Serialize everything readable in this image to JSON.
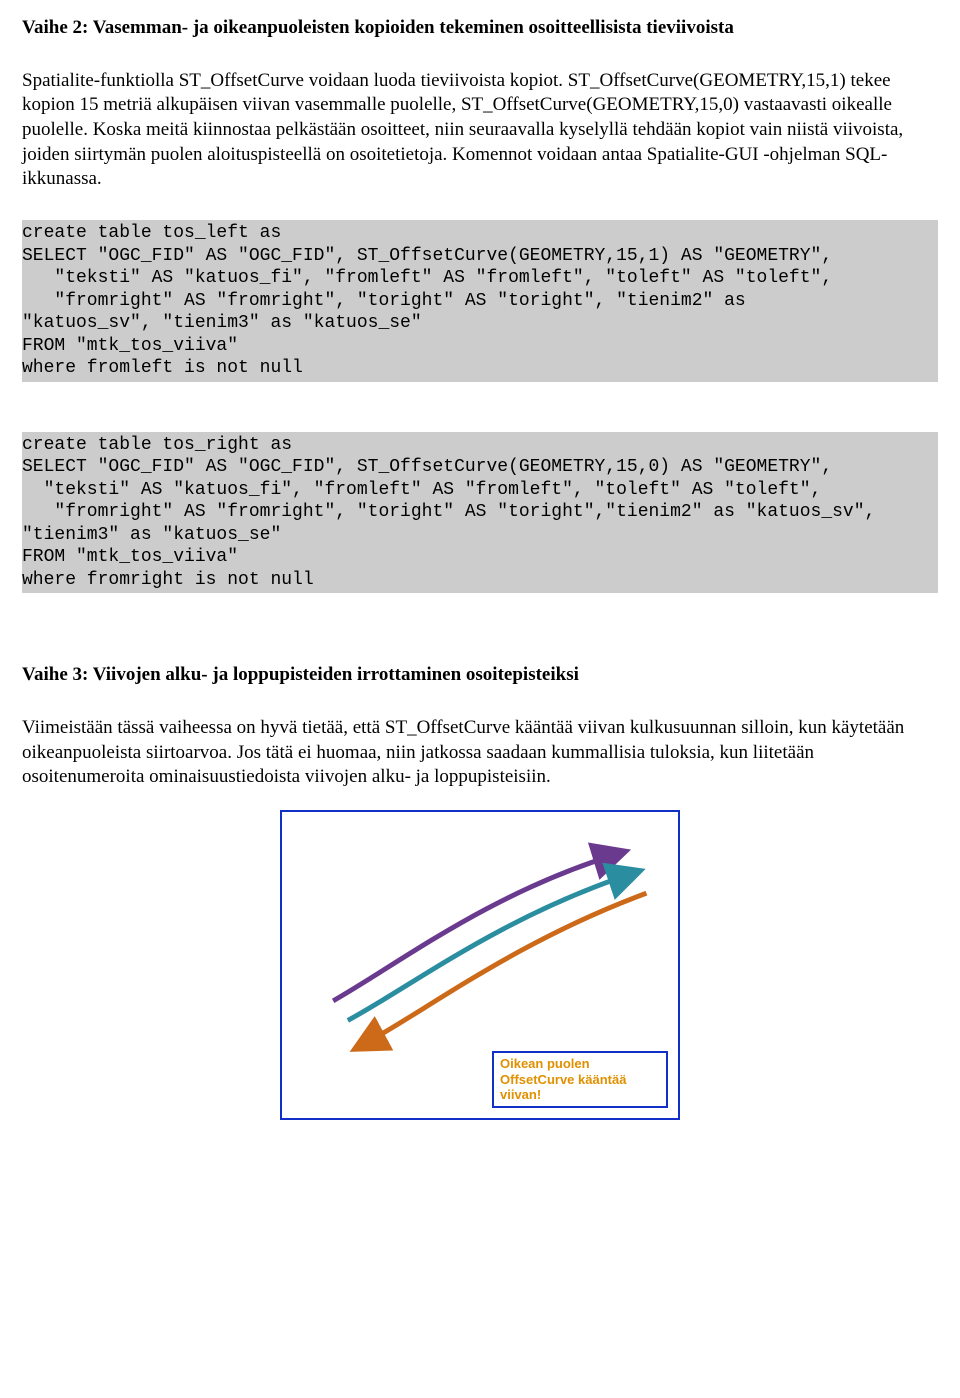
{
  "heading2": "Vaihe 2: Vasemman- ja oikeanpuoleisten kopioiden tekeminen osoitteellisista tieviivoista",
  "para1": "Spatialite-funktiolla ST_OffsetCurve voidaan luoda tieviivoista kopiot. ST_OffsetCurve(GEOMETRY,15,1) tekee kopion 15 metriä alkupäisen viivan vasemmalle puolelle, ST_OffsetCurve(GEOMETRY,15,0) vastaavasti oikealle puolelle. Koska meitä kiinnostaa pelkästään osoitteet, niin seuraavalla kyselyllä tehdään kopiot vain niistä viivoista, joiden siirtymän puolen aloituspisteellä on osoitetietoja. Komennot voidaan antaa Spatialite-GUI -ohjelman SQL-ikkunassa.",
  "code1": "create table tos_left as\nSELECT \"OGC_FID\" AS \"OGC_FID\", ST_OffsetCurve(GEOMETRY,15,1) AS \"GEOMETRY\",\n   \"teksti\" AS \"katuos_fi\", \"fromleft\" AS \"fromleft\", \"toleft\" AS \"toleft\",\n   \"fromright\" AS \"fromright\", \"toright\" AS \"toright\", \"tienim2\" as\n\"katuos_sv\", \"tienim3\" as \"katuos_se\"\nFROM \"mtk_tos_viiva\"\nwhere fromleft is not null",
  "code2": "create table tos_right as\nSELECT \"OGC_FID\" AS \"OGC_FID\", ST_OffsetCurve(GEOMETRY,15,0) AS \"GEOMETRY\",\n  \"teksti\" AS \"katuos_fi\", \"fromleft\" AS \"fromleft\", \"toleft\" AS \"toleft\",\n   \"fromright\" AS \"fromright\", \"toright\" AS \"toright\",\"tienim2\" as \"katuos_sv\",\n\"tienim3\" as \"katuos_se\"\nFROM \"mtk_tos_viiva\"\nwhere fromright is not null",
  "heading3": "Vaihe 3: Viivojen alku- ja loppupisteiden irrottaminen osoitepisteiksi",
  "para2": "Viimeistään tässä vaiheessa on hyvä tietää, että ST_OffsetCurve kääntää viivan kulkusuunnan silloin, kun käytetään oikeanpuoleista siirtoarvoa. Jos tätä ei huomaa, niin jatkossa saadaan kummallisia tuloksia, kun liitetään osoitenumeroita ominaisuustiedoista viivojen alku- ja loppupisteisiin.",
  "diagram": {
    "label": "Oikean puolen OffsetCurve kääntää viivan!",
    "colors": {
      "upper": "#6a3a8f",
      "middle": "#2b8da0",
      "lower": "#cc6a1a"
    }
  }
}
